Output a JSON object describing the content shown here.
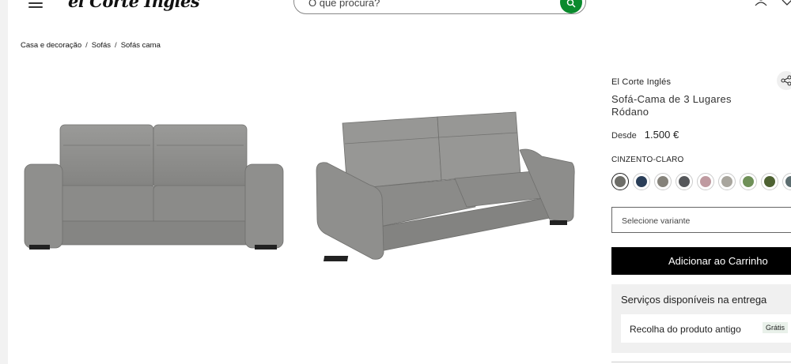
{
  "header": {
    "logo_text": "el Corte Inglés",
    "search_placeholder": "O que procura?"
  },
  "breadcrumb": [
    "Casa e decoração",
    "Sofás",
    "Sofás cama"
  ],
  "product": {
    "brand": "El Corte Inglés",
    "title": "Sofá-Cama de 3 Lugares Ródano",
    "price_prefix": "Desde",
    "price": "1.500 €",
    "color_label": "CINZENTO-CLARO",
    "swatches": [
      "#6d6d68",
      "#2a3e58",
      "#85827a",
      "#55575a",
      "#bf9aa0",
      "#a8a59d",
      "#6f9058",
      "#4e6232",
      "#5c6d70"
    ],
    "variant_placeholder": "Selecione variante",
    "add_to_cart_label": "Adicionar ao Carrinho"
  },
  "services": {
    "title": "Serviços disponíveis na entrega",
    "items": [
      {
        "name": "Recolha do produto antigo",
        "badge": "Grátis"
      }
    ]
  },
  "colors": {
    "search_button": "#0a8a2d",
    "sofa": "#8e8e8c"
  }
}
